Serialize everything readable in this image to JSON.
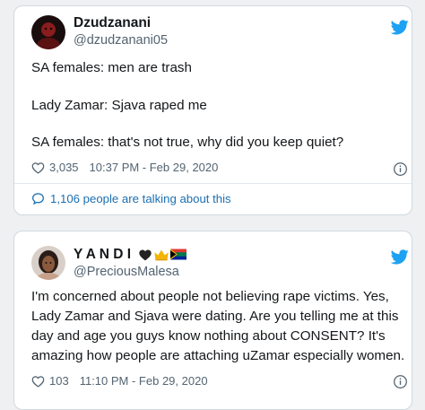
{
  "tweets": [
    {
      "display_name": "Dzudzanani",
      "handle": "@dzudzanani05",
      "lines": [
        "SA females: men are trash",
        "Lady Zamar: Sjava raped me",
        "SA females: that's not true, why did you keep quiet?"
      ],
      "likes": "3,035",
      "timestamp": "10:37 PM - Feb 29, 2020",
      "talking": "1,106 people are talking about this"
    },
    {
      "display_name": "Y A N D I",
      "name_badges": [
        "black-heart-icon",
        "crown-icon",
        "south-africa-flag-icon"
      ],
      "handle": "@PreciousMalesa",
      "lines": [
        "I'm concerned about people not believing rape victims. Yes,",
        "Lady Zamar and Sjava were dating. Are you telling me at this",
        "day and age you guys know nothing about CONSENT? It's",
        "amazing how people are attaching uZamar especially women."
      ],
      "likes": "103",
      "timestamp": "11:10 PM - Feb 29, 2020"
    }
  ],
  "colors": {
    "twitter_blue": "#1da1f2",
    "link_blue": "#1b6fb0",
    "muted_text": "#536471",
    "border": "#cfd9de"
  }
}
